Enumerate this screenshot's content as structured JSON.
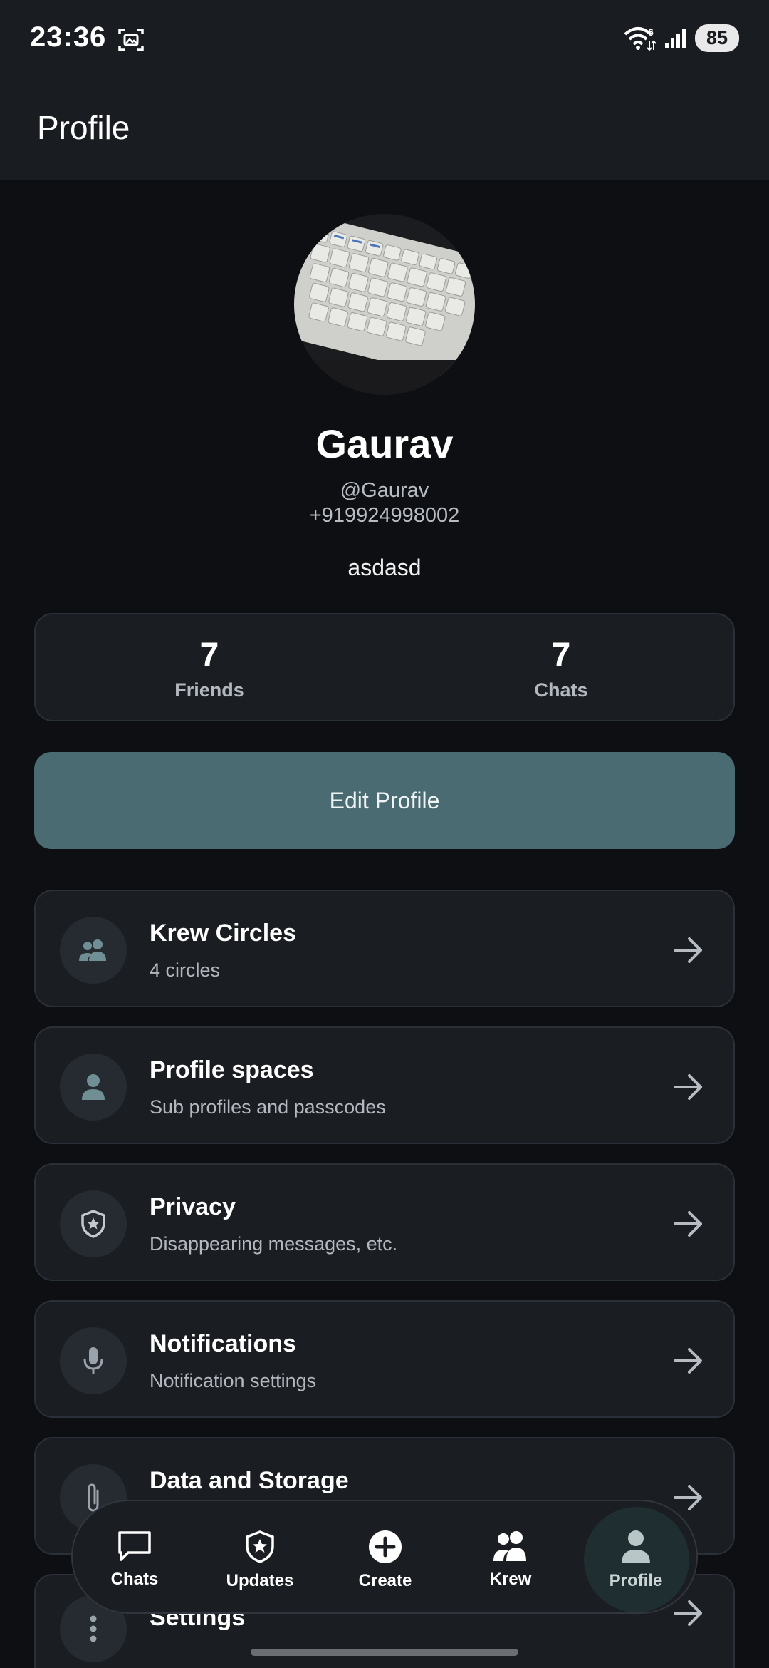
{
  "status_bar": {
    "time": "23:36",
    "battery": "85",
    "wifi_badge": "6"
  },
  "app_bar": {
    "title": "Profile"
  },
  "profile": {
    "name": "Gaurav",
    "handle": "@Gaurav",
    "phone": "+919924998002",
    "bio": "asdasd"
  },
  "stats": [
    {
      "value": "7",
      "label": "Friends"
    },
    {
      "value": "7",
      "label": "Chats"
    }
  ],
  "edit_button": "Edit Profile",
  "menu": [
    {
      "title": "Krew Circles",
      "subtitle": "4 circles",
      "icon": "group-icon"
    },
    {
      "title": "Profile spaces",
      "subtitle": "Sub profiles and passcodes",
      "icon": "person-icon"
    },
    {
      "title": "Privacy",
      "subtitle": "Disappearing messages, etc.",
      "icon": "shield-star-icon"
    },
    {
      "title": "Notifications",
      "subtitle": "Notification settings",
      "icon": "microphone-icon"
    },
    {
      "title": "Data and Storage",
      "subtitle": "",
      "icon": "paperclip-icon"
    },
    {
      "title": "Settings",
      "subtitle": "",
      "icon": "more-vertical-icon"
    }
  ],
  "bottom_nav": [
    {
      "label": "Chats",
      "icon": "chat-bubble-icon"
    },
    {
      "label": "Updates",
      "icon": "shield-star-icon"
    },
    {
      "label": "Create",
      "icon": "plus-circle-icon"
    },
    {
      "label": "Krew",
      "icon": "group-icon"
    },
    {
      "label": "Profile",
      "icon": "person-icon",
      "active": true
    }
  ],
  "colors": {
    "background": "#0d0f12",
    "surface": "#1a1d22",
    "accent": "#4a6b71",
    "muted_text": "#b3b8bf"
  }
}
